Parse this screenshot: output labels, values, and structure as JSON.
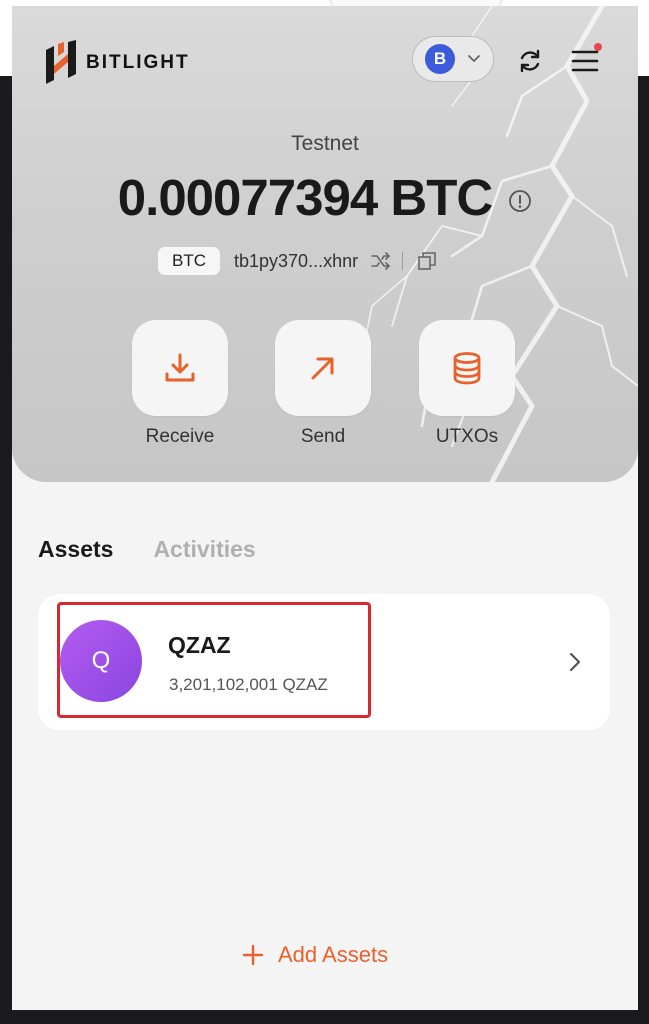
{
  "app": {
    "brand": "BITLIGHT",
    "network": "Testnet",
    "balance": "0.00077394 BTC",
    "network_coin_symbol": "B",
    "icons": [
      "bitlight-logo",
      "bitcoin-icon",
      "chevron-down-icon",
      "refresh-icon",
      "menu-icon",
      "info-icon",
      "shuffle-icon",
      "copy-icon",
      "download-icon",
      "arrow-up-right-icon",
      "database-icon",
      "chevron-right-icon",
      "plus-icon"
    ]
  },
  "address": {
    "chip": "BTC",
    "short": "tb1py370...xhnr"
  },
  "actions": [
    {
      "label": "Receive"
    },
    {
      "label": "Send"
    },
    {
      "label": "UTXOs"
    }
  ],
  "tabs": [
    {
      "label": "Assets",
      "active": true
    },
    {
      "label": "Activities",
      "active": false
    }
  ],
  "assets": [
    {
      "initial": "Q",
      "name": "QZAZ",
      "amount": "3,201,102,001 QZAZ"
    }
  ],
  "footer": {
    "add_label": "Add Assets"
  },
  "colors": {
    "accent": "#e8612c",
    "highlight": "#d9282f",
    "avatar": "#9b4fe6",
    "btc_badge": "#3b5bdb"
  }
}
